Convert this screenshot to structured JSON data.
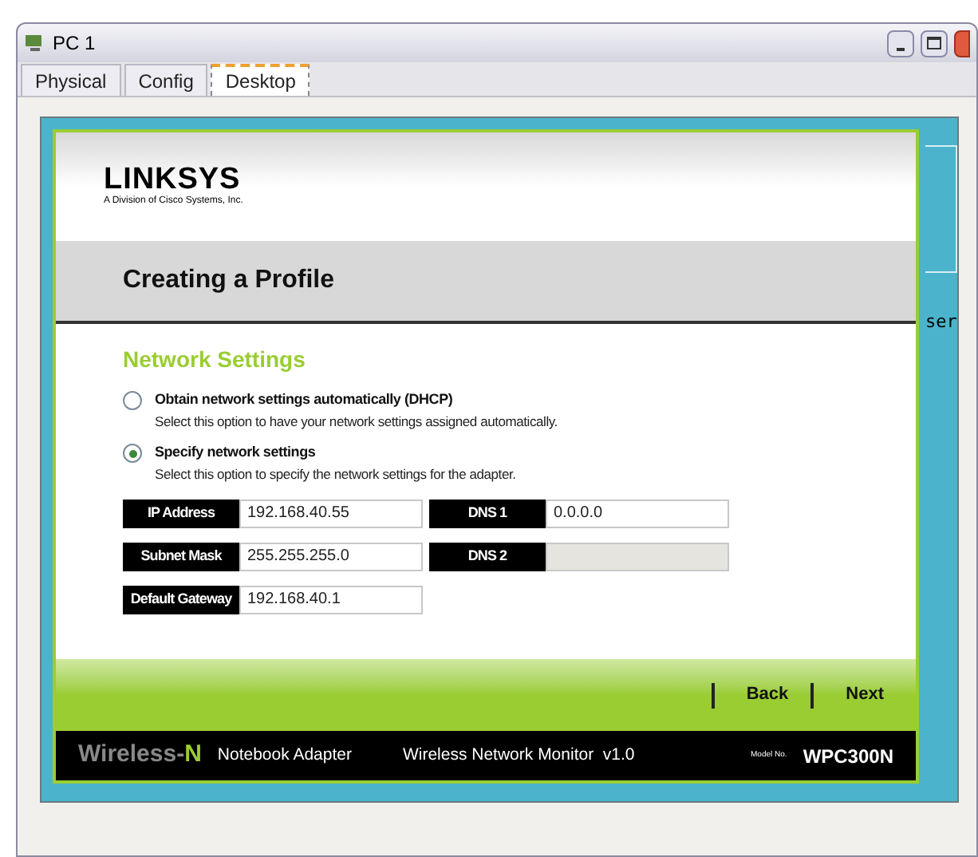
{
  "window": {
    "title": "PC 1"
  },
  "tabs": [
    {
      "label": "Physical",
      "selected": false
    },
    {
      "label": "Config",
      "selected": false
    },
    {
      "label": "Desktop",
      "selected": true
    }
  ],
  "desktop": {
    "partial_label": "ser"
  },
  "dialog": {
    "logo": "LINKSYS",
    "logo_subtitle": "A Division of Cisco Systems, Inc.",
    "heading": "Creating a Profile",
    "section_title": "Network Settings",
    "options": [
      {
        "label": "Obtain network settings automatically (DHCP)",
        "description": "Select this option to have your network settings assigned automatically.",
        "selected": false
      },
      {
        "label": "Specify network settings",
        "description": "Select this option to specify the network settings for the adapter.",
        "selected": true
      }
    ],
    "fields": [
      {
        "label": "IP Address",
        "value": "192.168.40.55",
        "disabled": false
      },
      {
        "label": "DNS 1",
        "value": "0.0.0.0",
        "disabled": false
      },
      {
        "label": "Subnet Mask",
        "value": "255.255.255.0",
        "disabled": false
      },
      {
        "label": "DNS 2",
        "disabled": true
      },
      {
        "label": "Default Gateway",
        "value": "192.168.40.1",
        "disabled": false
      }
    ],
    "buttons": [
      "Back",
      "Next"
    ],
    "footer": {
      "brand_prefix": "Wireless-",
      "brand_suffix": "N",
      "product": "Notebook Adapter",
      "app": "Wireless Network Monitor  v1.0",
      "model_label": "Model No.",
      "model": "WPC300N"
    }
  }
}
